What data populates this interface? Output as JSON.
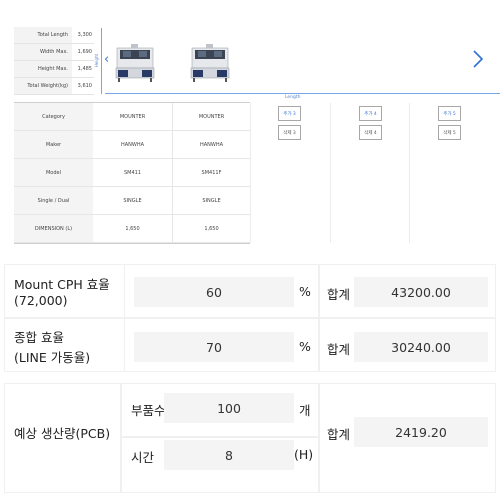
{
  "dimensions": [
    {
      "key": "Total Length",
      "value": "3,300"
    },
    {
      "key": "Width Max.",
      "value": "1,690"
    },
    {
      "key": "Height Max.",
      "value": "1,485"
    },
    {
      "key": "Total Weight(kg)",
      "value": "3,610"
    }
  ],
  "rulers": {
    "vertical_label": "Height",
    "horizontal_label": "Length"
  },
  "spec": {
    "rows": [
      {
        "label": "Category",
        "c1": "MOUNTER",
        "c2": "MOUNTER"
      },
      {
        "label": "Maker",
        "c1": "HANWHA",
        "c2": "HANWHA"
      },
      {
        "label": "Model",
        "c1": "SM411",
        "c2": "SM411F"
      },
      {
        "label": "Single / Dual",
        "c1": "SINGLE",
        "c2": "SINGLE"
      },
      {
        "label": "DIMENSION (L)",
        "c1": "1,650",
        "c2": "1,650"
      }
    ],
    "slots": [
      {
        "add": "추가 3",
        "del": "삭제 3"
      },
      {
        "add": "추가 4",
        "del": "삭제 4"
      },
      {
        "add": "추가 5",
        "del": "삭제 5"
      }
    ]
  },
  "efficiency": {
    "mount_label_line1": "Mount CPH 효율",
    "mount_label_line2": "(72,000)",
    "mount_value": "60",
    "mount_unit": "%",
    "mount_total_label": "합계",
    "mount_total": "43200.00",
    "line_label_line1": "종합 효율",
    "line_label_line2": "(LINE 가동율)",
    "line_value": "70",
    "line_unit": "%",
    "line_total_label": "합계",
    "line_total": "30240.00"
  },
  "production": {
    "label": "예상 생산량(PCB)",
    "parts_label": "부품수",
    "parts_value": "100",
    "parts_unit": "개",
    "time_label": "시간",
    "time_value": "8",
    "time_unit": "(H)",
    "total_label": "합계",
    "total": "2419.20"
  }
}
